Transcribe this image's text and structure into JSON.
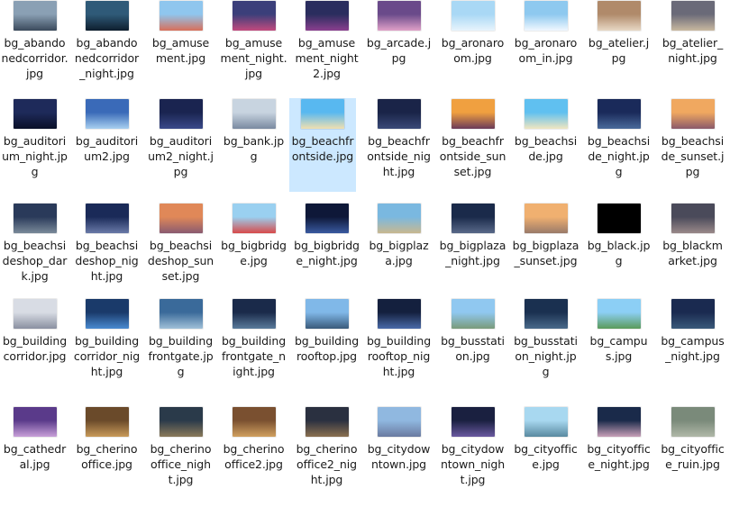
{
  "window": {
    "view": "Large icons",
    "selected_file": "bg_beachfrontside.jpg"
  },
  "files": [
    {
      "name": "bg_abandonedcorridor.jpg",
      "thumb": [
        "#8aa0b4",
        "#3b4a5c"
      ]
    },
    {
      "name": "bg_abandonedcorridor_night.jpg",
      "thumb": [
        "#2f5a78",
        "#0e1e2e"
      ]
    },
    {
      "name": "bg_amusement.jpg",
      "thumb": [
        "#8fc6ee",
        "#d86f5a"
      ]
    },
    {
      "name": "bg_amusement_night.jpg",
      "thumb": [
        "#3b3f7a",
        "#c24a7e"
      ]
    },
    {
      "name": "bg_amusement_night2.jpg",
      "thumb": [
        "#2a2d5e",
        "#8a3f8f"
      ]
    },
    {
      "name": "bg_arcade.jpg",
      "thumb": [
        "#6a4a8a",
        "#e0a0c8"
      ]
    },
    {
      "name": "bg_aronaroom.jpg",
      "thumb": [
        "#a9d8f5",
        "#e8f4fc"
      ]
    },
    {
      "name": "bg_aronaroom_in.jpg",
      "thumb": [
        "#8ec9ef",
        "#f0f8ff"
      ]
    },
    {
      "name": "bg_atelier.jpg",
      "thumb": [
        "#b08a6a",
        "#e8d8c4"
      ]
    },
    {
      "name": "bg_atelier_night.jpg",
      "thumb": [
        "#6a6a78",
        "#c8b8a0"
      ]
    },
    {
      "name": "bg_auditorium_night.jpg",
      "thumb": [
        "#1e2a5a",
        "#0a1028"
      ]
    },
    {
      "name": "bg_auditorium2.jpg",
      "thumb": [
        "#3a6ab8",
        "#a8cff0"
      ]
    },
    {
      "name": "bg_auditorium2_night.jpg",
      "thumb": [
        "#1a2450",
        "#3a4a8a"
      ]
    },
    {
      "name": "bg_bank.jpg",
      "thumb": [
        "#c8d4e0",
        "#7a8aa0"
      ]
    },
    {
      "name": "bg_beachfrontside.jpg",
      "thumb": [
        "#58b8f0",
        "#f0e0b0"
      ]
    },
    {
      "name": "bg_beachfrontside_night.jpg",
      "thumb": [
        "#1a2448",
        "#3a4a78"
      ]
    },
    {
      "name": "bg_beachfrontside_sunset.jpg",
      "thumb": [
        "#f0a040",
        "#6a3a58"
      ]
    },
    {
      "name": "bg_beachside.jpg",
      "thumb": [
        "#60c0f0",
        "#f0e6c0"
      ]
    },
    {
      "name": "bg_beachside_night.jpg",
      "thumb": [
        "#1a2a5a",
        "#4a6a9a"
      ]
    },
    {
      "name": "bg_beachside_sunset.jpg",
      "thumb": [
        "#f0a860",
        "#8a5a6a"
      ]
    },
    {
      "name": "bg_beachsideshop_dark.jpg",
      "thumb": [
        "#2a3a5a",
        "#7a8a9a"
      ]
    },
    {
      "name": "bg_beachsideshop_night.jpg",
      "thumb": [
        "#1a2a58",
        "#6a7aa8"
      ]
    },
    {
      "name": "bg_beachsideshop_sunset.jpg",
      "thumb": [
        "#e08858",
        "#8a5a70"
      ]
    },
    {
      "name": "bg_bigbridge.jpg",
      "thumb": [
        "#9ad0f0",
        "#d84a4a"
      ]
    },
    {
      "name": "bg_bigbridge_night.jpg",
      "thumb": [
        "#0e1838",
        "#3a5aa0"
      ]
    },
    {
      "name": "bg_bigplaza.jpg",
      "thumb": [
        "#7ab8e0",
        "#c8b890"
      ]
    },
    {
      "name": "bg_bigplaza_night.jpg",
      "thumb": [
        "#1a2a4a",
        "#5a6a8a"
      ]
    },
    {
      "name": "bg_bigplaza_sunset.jpg",
      "thumb": [
        "#f0b070",
        "#9a7a6a"
      ]
    },
    {
      "name": "bg_black.jpg",
      "thumb": [
        "#000000",
        "#000000"
      ]
    },
    {
      "name": "bg_blackmarket.jpg",
      "thumb": [
        "#4a4a5a",
        "#9a8a8a"
      ]
    },
    {
      "name": "bg_buildingcorridor.jpg",
      "thumb": [
        "#d8dce4",
        "#8a90a0"
      ]
    },
    {
      "name": "bg_buildingcorridor_night.jpg",
      "thumb": [
        "#1a3a6a",
        "#4a8ad0"
      ]
    },
    {
      "name": "bg_buildingfrontgate.jpg",
      "thumb": [
        "#3a6a9a",
        "#a0c0d8"
      ]
    },
    {
      "name": "bg_buildingfrontgate_night.jpg",
      "thumb": [
        "#1a2a4a",
        "#5a7a9a"
      ]
    },
    {
      "name": "bg_buildingrooftop.jpg",
      "thumb": [
        "#80b8e8",
        "#3a5a7a"
      ]
    },
    {
      "name": "bg_buildingrooftop_night.jpg",
      "thumb": [
        "#14203e",
        "#4a6aa8"
      ]
    },
    {
      "name": "bg_busstation.jpg",
      "thumb": [
        "#90c8f0",
        "#7a9a7a"
      ]
    },
    {
      "name": "bg_busstation_night.jpg",
      "thumb": [
        "#1a3050",
        "#4a6a8a"
      ]
    },
    {
      "name": "bg_campus.jpg",
      "thumb": [
        "#8ccff5",
        "#5a9a5a"
      ]
    },
    {
      "name": "bg_campus_night.jpg",
      "thumb": [
        "#1a2a50",
        "#3a5a7a"
      ]
    },
    {
      "name": "bg_cathedral.jpg",
      "thumb": [
        "#5a3a8a",
        "#c8a0d8"
      ]
    },
    {
      "name": "bg_cherinooffice.jpg",
      "thumb": [
        "#6a4a2a",
        "#c89a5a"
      ]
    },
    {
      "name": "bg_cherinooffice_night.jpg",
      "thumb": [
        "#2a3a4a",
        "#8a7a5a"
      ]
    },
    {
      "name": "bg_cherinooffice2.jpg",
      "thumb": [
        "#7a5030",
        "#d0a060"
      ]
    },
    {
      "name": "bg_cherinooffice2_night.jpg",
      "thumb": [
        "#2a3040",
        "#8a7050"
      ]
    },
    {
      "name": "bg_citydowntown.jpg",
      "thumb": [
        "#90b8e0",
        "#6a7aa0"
      ]
    },
    {
      "name": "bg_citydowntown_night.jpg",
      "thumb": [
        "#1a2040",
        "#6a5aa0"
      ]
    },
    {
      "name": "bg_cityoffice.jpg",
      "thumb": [
        "#a8d8f0",
        "#5a8aa0"
      ]
    },
    {
      "name": "bg_cityoffice_night.jpg",
      "thumb": [
        "#1a2a4a",
        "#c8a0b8"
      ]
    },
    {
      "name": "bg_cityoffice_ruin.jpg",
      "thumb": [
        "#7a8a7a",
        "#b0b8a8"
      ]
    }
  ]
}
